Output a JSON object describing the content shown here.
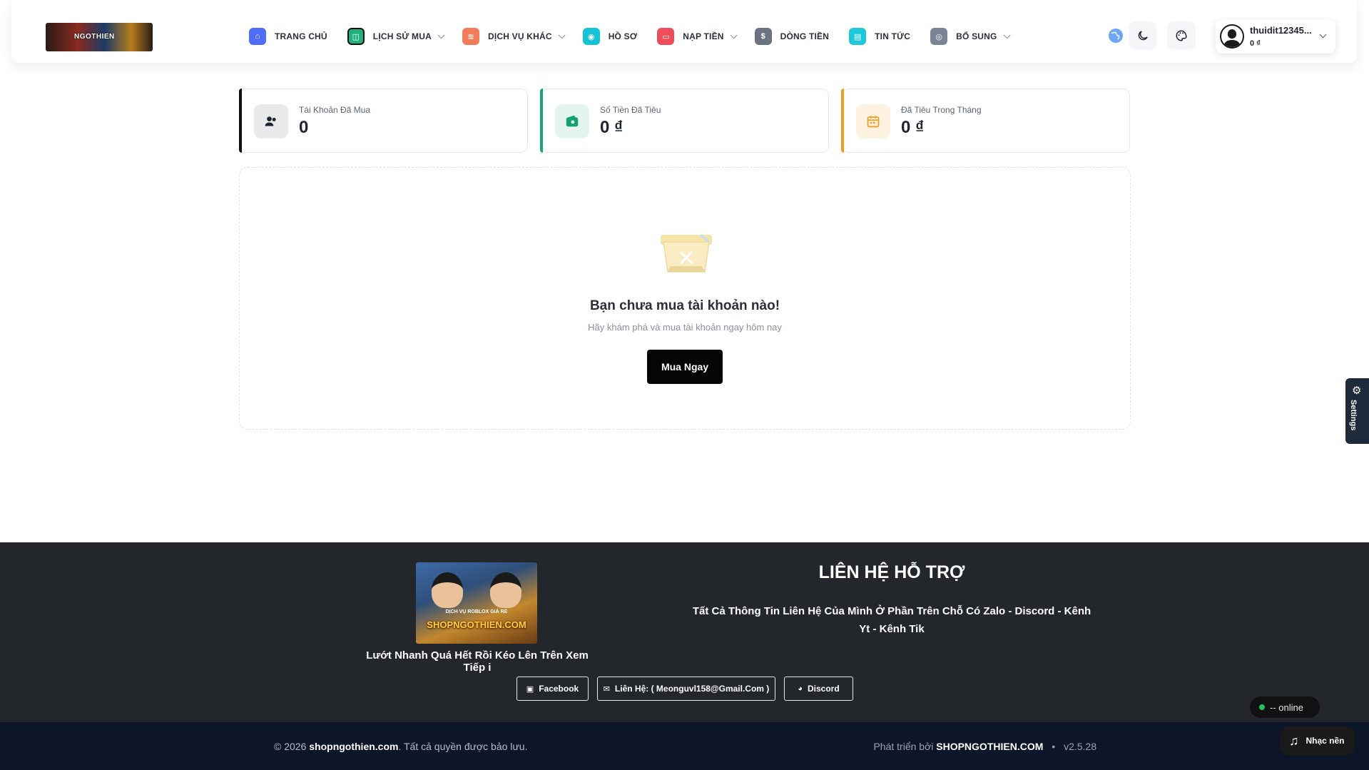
{
  "header": {
    "logo_text": "NGOTHIEN",
    "nav": [
      {
        "label": "TRANG CHỦ",
        "icon": "home-icon",
        "color": "#4f6ef7",
        "glyph": "⌂",
        "has_dropdown": false
      },
      {
        "label": "LỊCH SỬ MUA",
        "icon": "history-icon",
        "color": "#22b07d",
        "glyph": "◫",
        "has_dropdown": true
      },
      {
        "label": "DỊCH VỤ KHÁC",
        "icon": "layers-icon",
        "color": "#f07c5a",
        "glyph": "≋",
        "has_dropdown": true
      },
      {
        "label": "HỒ SƠ",
        "icon": "profile-icon",
        "color": "#14c3d6",
        "glyph": "◉",
        "has_dropdown": false
      },
      {
        "label": "NẠP TIỀN",
        "icon": "wallet-icon",
        "color": "#ef4d5a",
        "glyph": "▭",
        "has_dropdown": true
      },
      {
        "label": "DÒNG TIỀN",
        "icon": "dollar-icon",
        "color": "#6b7280",
        "glyph": "$",
        "has_dropdown": false
      },
      {
        "label": "TIN TỨC",
        "icon": "news-icon",
        "color": "#1ec8d8",
        "glyph": "▤",
        "has_dropdown": false
      },
      {
        "label": "BỔ SUNG",
        "icon": "extra-icon",
        "color": "#7b8494",
        "glyph": "◎",
        "has_dropdown": true
      }
    ],
    "user": {
      "name": "thuidit12345...",
      "balance": "0 ₫"
    }
  },
  "stats": [
    {
      "label": "Tài Khoản Đã Mua",
      "value": "0",
      "accent": "#111111",
      "icon_bg": "#e9eaec",
      "icon_color": "#1f2430"
    },
    {
      "label": "Số Tiền Đã Tiêu",
      "value": "0 ₫",
      "accent": "#1aa37a",
      "icon_bg": "#e3f5ee",
      "icon_color": "#14a06f"
    },
    {
      "label": "Đã Tiêu Trong Tháng",
      "value": "0 ₫",
      "accent": "#f29b1d",
      "icon_bg": "#fdf1df",
      "icon_color": "#f29b1d"
    }
  ],
  "empty": {
    "title": "Bạn chưa mua tài khoản nào!",
    "subtitle": "Hãy khám phá và mua tài khoản ngay hôm nay",
    "button": "Mua Ngay"
  },
  "settings_tab": {
    "label": "Settings"
  },
  "footer": {
    "image_sub": "DỊCH VỤ ROBLOX GIÁ RẺ",
    "image_brand": "SHOPNGOTHIEN.COM",
    "tagline": "Lướt Nhanh Quá Hết Rồi Kéo Lên Trên Xem Tiếp i",
    "contact_heading": "LIÊN HỆ HỖ TRỢ",
    "contact_text": "Tất Cả Thông Tin Liên Hệ Của Mình Ở Phần Trên Chỗ Có Zalo - Discord - Kênh Yt - Kênh Tik",
    "buttons": [
      {
        "label": "Facebook",
        "icon": "facebook-icon"
      },
      {
        "label": "Liên Hệ: ( Meonguvl158@Gmail.Com )",
        "icon": "mail-icon"
      },
      {
        "label": "Discord",
        "icon": "discord-icon"
      }
    ]
  },
  "bottom": {
    "copy_prefix": "© 2026",
    "copy_site": "shopngothien.com",
    "copy_suffix": ". Tất cả quyền được bảo lưu.",
    "dev_prefix": "Phát triển bởi",
    "dev_name": "SHOPNGOTHIEN.COM",
    "dot": "•",
    "version": "v2.5.28"
  },
  "widgets": {
    "online": "-- online",
    "music": "Nhạc nền"
  }
}
